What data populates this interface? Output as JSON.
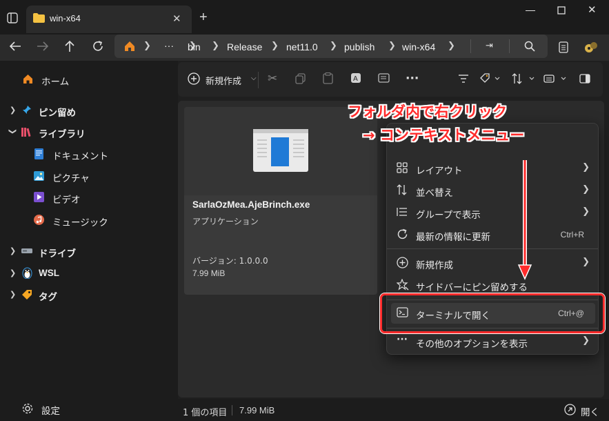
{
  "window": {
    "tab_title": "win-x64",
    "new_tab": "+"
  },
  "address": {
    "more": "···",
    "crumbs": [
      "bin",
      "Release",
      "net11.0",
      "publish",
      "win-x64"
    ]
  },
  "toolbar": {
    "new_label": "新規作成"
  },
  "sidebar": {
    "home": "ホーム",
    "pinned": "ピン留め",
    "library": "ライブラリ",
    "documents": "ドキュメント",
    "pictures": "ピクチャ",
    "videos": "ビデオ",
    "music": "ミュージック",
    "drives": "ドライブ",
    "wsl": "WSL",
    "tags": "タグ",
    "settings": "設定"
  },
  "file": {
    "name": "SarlaOzMea.AjeBrinch.exe",
    "type": "アプリケーション",
    "version": "バージョン: 1.0.0.0",
    "size": "7.99 MiB"
  },
  "menu": {
    "layout": "レイアウト",
    "sort": "並べ替え",
    "group": "グループで表示",
    "refresh": "最新の情報に更新",
    "refresh_shortcut": "Ctrl+R",
    "new": "新規作成",
    "pin": "サイドバーにピン留めする",
    "terminal": "ターミナルで開く",
    "terminal_shortcut": "Ctrl+@",
    "more": "その他のオプションを表示"
  },
  "annotation": {
    "line1": "フォルダ内で右クリック",
    "line2": "→ コンテキストメニュー"
  },
  "status": {
    "count": "1 個の項目",
    "size": "7.99 MiB",
    "open": "開く"
  },
  "colors": {
    "accent": "#ff2b2b",
    "folder": "#f5c242",
    "home": "#f08a24"
  }
}
